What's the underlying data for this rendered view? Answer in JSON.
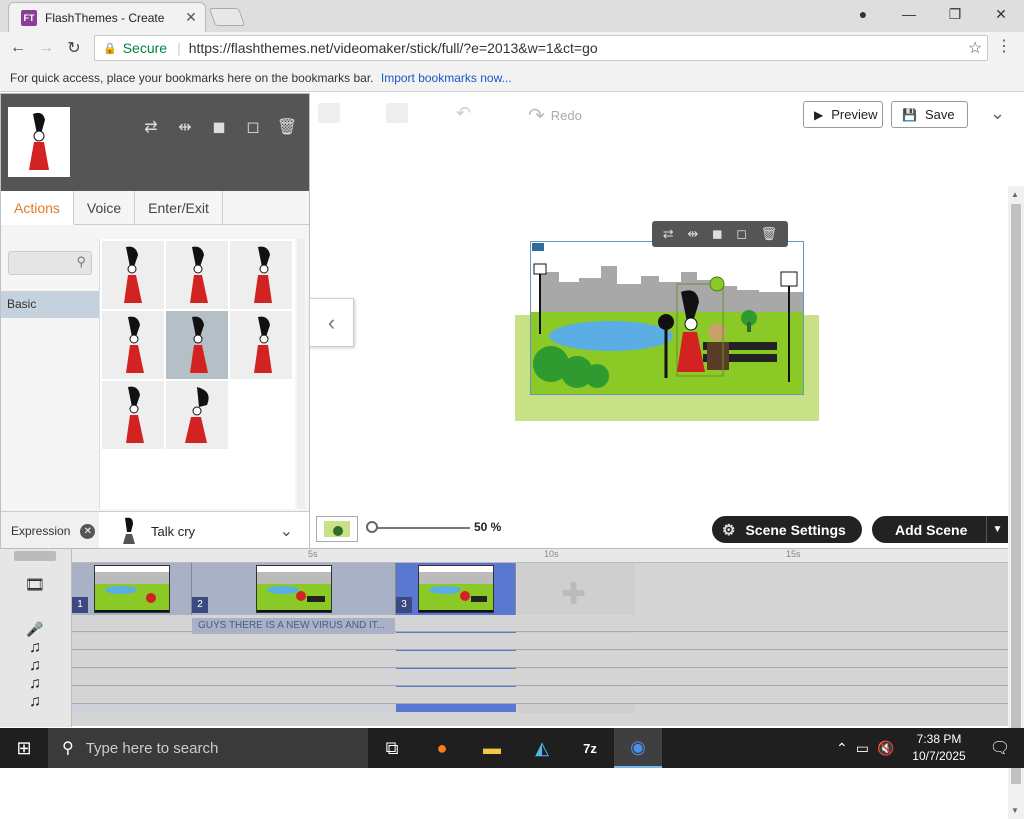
{
  "browser": {
    "tab_title": "FlashThemes - Create",
    "favicon_text": "FT",
    "url_secure_label": "Secure",
    "url": "https://flashthemes.net/videomaker/stick/full/?e=2013&w=1&ct=go",
    "bookmarks_hint": "For quick access, place your bookmarks here on the bookmarks bar.",
    "bookmarks_link": "Import bookmarks now..."
  },
  "toolbar": {
    "redo_label": "Redo",
    "preview_label": "Preview",
    "save_label": "Save"
  },
  "char_panel": {
    "tabs": [
      {
        "label": "Actions",
        "active": true
      },
      {
        "label": "Voice",
        "active": false
      },
      {
        "label": "Enter/Exit",
        "active": false
      }
    ],
    "category": "Basic",
    "expression_label": "Expression",
    "expression_value": "Talk cry"
  },
  "stage": {
    "zoom_label": "50 %"
  },
  "buttons": {
    "scene_settings": "Scene Settings",
    "add_scene": "Add Scene"
  },
  "timeline": {
    "ruler_ticks": [
      "5s",
      "10s",
      "15s"
    ],
    "scenes": [
      {
        "num": "1"
      },
      {
        "num": "2"
      },
      {
        "num": "3"
      }
    ],
    "voice_clip": "GUYS THERE IS A NEW VIRUS AND IT..."
  },
  "taskbar": {
    "search_placeholder": "Type here to search",
    "time": "7:38 PM",
    "date": "10/7/2025"
  },
  "colors": {
    "accent_tab": "#e07a26",
    "timeline_selected": "#5a78d1",
    "stage_grass": "#c8e086"
  }
}
